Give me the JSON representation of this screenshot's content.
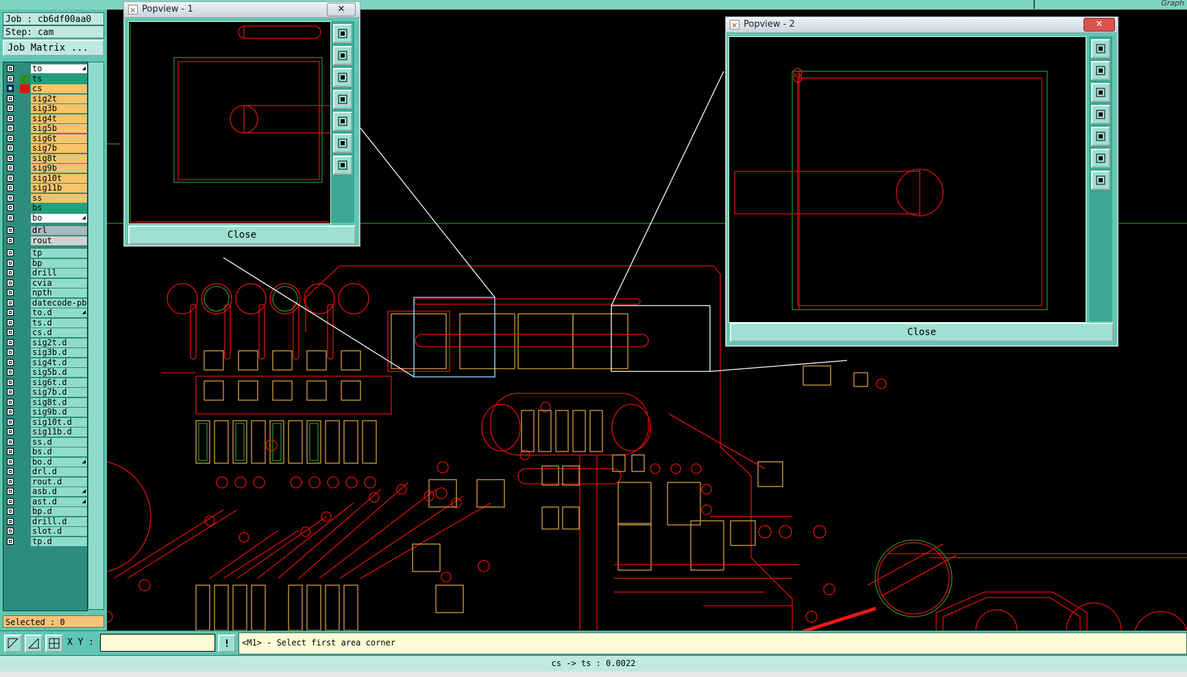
{
  "topbar": {
    "graph_label": "Graph"
  },
  "job_info": {
    "job": "Job : cb6df00aa0",
    "step": "Step: cam"
  },
  "job_matrix_label": "Job Matrix ...",
  "layers_top": [
    {
      "name": "to",
      "bg": "#ffffff",
      "color": "",
      "flag": true
    },
    {
      "name": "ts",
      "bg": "#1ea37f",
      "color": "#2e8b2e",
      "flag": false
    },
    {
      "name": "cs",
      "bg": "#f7c46a",
      "color": "#e01010",
      "flag": false,
      "active": true
    },
    {
      "name": "sig2t",
      "bg": "#f7c46a",
      "color": ""
    },
    {
      "name": "sig3b",
      "bg": "#f7c46a",
      "color": ""
    },
    {
      "name": "sig4t",
      "bg": "#f7c46a",
      "color": ""
    },
    {
      "name": "sig5b",
      "bg": "#f7c46a",
      "color": ""
    },
    {
      "name": "sig6t",
      "bg": "#f7c46a",
      "color": ""
    },
    {
      "name": "sig7b",
      "bg": "#f7c46a",
      "color": ""
    },
    {
      "name": "sig8t",
      "bg": "#f7c46a",
      "color": ""
    },
    {
      "name": "sig9b",
      "bg": "#f7c46a",
      "color": ""
    },
    {
      "name": "sig10t",
      "bg": "#f7c46a",
      "color": ""
    },
    {
      "name": "sig11b",
      "bg": "#f7c46a",
      "color": ""
    },
    {
      "name": "ss",
      "bg": "#f7c46a",
      "color": ""
    },
    {
      "name": "bs",
      "bg": "#1ea37f",
      "color": ""
    },
    {
      "name": "bo",
      "bg": "#ffffff",
      "color": "",
      "flag": true
    }
  ],
  "layers_drill": [
    {
      "name": "drl",
      "bg": "#a9b8bd",
      "color": ""
    },
    {
      "name": "rout",
      "bg": "#d2d2d2",
      "color": ""
    }
  ],
  "layers_misc": [
    {
      "name": "tp",
      "bg": "#8fdccb"
    },
    {
      "name": "bp",
      "bg": "#8fdccb"
    },
    {
      "name": "drill",
      "bg": "#8fdccb"
    },
    {
      "name": "cvia",
      "bg": "#8fdccb"
    },
    {
      "name": "npth",
      "bg": "#8fdccb"
    },
    {
      "name": "datecode-pbe",
      "bg": "#8fdccb"
    },
    {
      "name": "to.d",
      "bg": "#8fdccb",
      "flag": true
    },
    {
      "name": "ts.d",
      "bg": "#8fdccb"
    },
    {
      "name": "cs.d",
      "bg": "#8fdccb"
    },
    {
      "name": "sig2t.d",
      "bg": "#8fdccb"
    },
    {
      "name": "sig3b.d",
      "bg": "#8fdccb"
    },
    {
      "name": "sig4t.d",
      "bg": "#8fdccb"
    },
    {
      "name": "sig5b.d",
      "bg": "#8fdccb"
    },
    {
      "name": "sig6t.d",
      "bg": "#8fdccb"
    },
    {
      "name": "sig7b.d",
      "bg": "#8fdccb"
    },
    {
      "name": "sig8t.d",
      "bg": "#8fdccb"
    },
    {
      "name": "sig9b.d",
      "bg": "#8fdccb"
    },
    {
      "name": "sig10t.d",
      "bg": "#8fdccb"
    },
    {
      "name": "sig11b.d",
      "bg": "#8fdccb"
    },
    {
      "name": "ss.d",
      "bg": "#8fdccb"
    },
    {
      "name": "bs.d",
      "bg": "#8fdccb"
    },
    {
      "name": "bo.d",
      "bg": "#8fdccb",
      "flag": true
    },
    {
      "name": "drl.d",
      "bg": "#8fdccb"
    },
    {
      "name": "rout.d",
      "bg": "#8fdccb"
    },
    {
      "name": "asb.d",
      "bg": "#8fdccb",
      "flag": true
    },
    {
      "name": "ast.d",
      "bg": "#8fdccb",
      "flag": true
    },
    {
      "name": "bp.d",
      "bg": "#8fdccb"
    },
    {
      "name": "drill.d",
      "bg": "#8fdccb"
    },
    {
      "name": "slot.d",
      "bg": "#8fdccb"
    },
    {
      "name": "tp.d",
      "bg": "#8fdccb"
    }
  ],
  "selected_label": "Selected : 0",
  "popup1": {
    "title": "Popview - 1",
    "close_label": "Close"
  },
  "popup2": {
    "title": "Popview - 2",
    "close_label": "Close"
  },
  "cmd": {
    "xy_label": "X Y :",
    "xy_value": "",
    "message": "<M1> - Select first area corner",
    "info_icon": "!"
  },
  "status": {
    "text": "cs -> ts : 0.0022"
  },
  "colors": {
    "panel": "#5fc7b3",
    "canvas": "#000000",
    "trace_red": "#e01010",
    "trace_green": "#2e8b2e",
    "trace_orange": "#d8a040",
    "annotation_arrow": "#e81818"
  },
  "icons": {
    "popup_tools": [
      "zoom-window-icon",
      "pan-up-icon",
      "pan-down-icon",
      "pan-left-icon",
      "pan-right-icon",
      "zoom-fit-icon",
      "zoom-center-icon"
    ]
  }
}
